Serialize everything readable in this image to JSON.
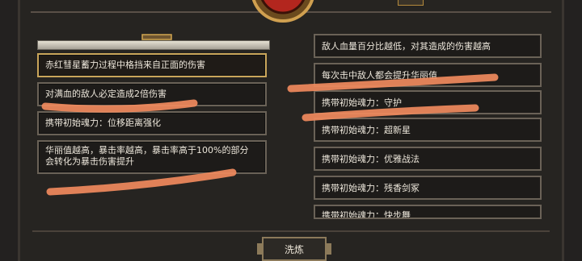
{
  "left_panel": {
    "cards": [
      {
        "text": "赤红彗星蓄力过程中格挡来自正面的伤害",
        "selected": true
      },
      {
        "text": "对满血的敌人必定造成2倍伤害",
        "selected": false
      },
      {
        "text": "携带初始魂力：位移距离强化",
        "selected": false
      },
      {
        "text": "华丽值越高，暴击率越高，暴击率高于100%的部分\n会转化为暴击伤害提升",
        "selected": false
      }
    ]
  },
  "right_panel": {
    "cards": [
      {
        "text": "敌人血量百分比越低，对其造成的伤害越高"
      },
      {
        "text": "每次击中敌人都会提升华丽值"
      },
      {
        "text": "携带初始魂力：守护"
      },
      {
        "text": "携带初始魂力：超新星"
      },
      {
        "text": "携带初始魂力：优雅战法"
      },
      {
        "text": "携带初始魂力：残香剑冢"
      },
      {
        "text": "携带初始魂力：快步舞"
      }
    ]
  },
  "refine_button": {
    "label": "洗炼"
  },
  "colors": {
    "accent_gold": "#c9a55a",
    "emblem_red": "#b3261e",
    "scribble": "#f08a5d"
  }
}
